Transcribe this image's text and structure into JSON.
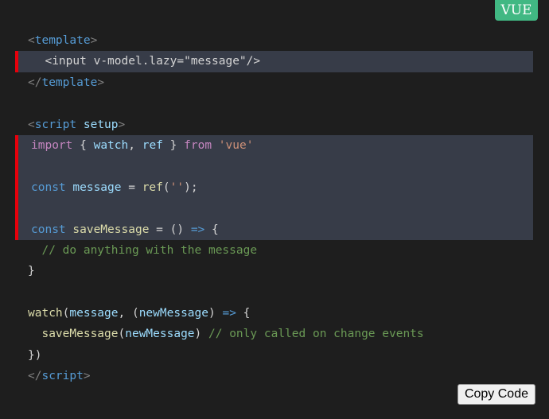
{
  "badge": {
    "label": "VUE",
    "color": "#41b883"
  },
  "copy_button": {
    "label": "Copy Code"
  },
  "highlight_color": "#e8000b",
  "code": {
    "l1": [
      "<",
      "template",
      ">"
    ],
    "l2": [
      "  <",
      "input",
      " ",
      "v-model.lazy",
      "=",
      "\"message\"",
      "/>"
    ],
    "l3": [
      "</",
      "template",
      ">"
    ],
    "l5": [
      "<",
      "script",
      " ",
      "setup",
      ">"
    ],
    "l6": [
      "import",
      " { ",
      "watch",
      ", ",
      "ref",
      " } ",
      "from",
      " ",
      "'vue'"
    ],
    "l8": [
      "const",
      " ",
      "message",
      " = ",
      "ref",
      "(",
      "''",
      ");"
    ],
    "l10": [
      "const",
      " ",
      "saveMessage",
      " = () ",
      "=>",
      " {"
    ],
    "l11": [
      "  // do anything with the message"
    ],
    "l12": [
      "}"
    ],
    "l14": [
      "watch",
      "(",
      "message",
      ", (",
      "newMessage",
      ") ",
      "=>",
      " {"
    ],
    "l15": [
      "  ",
      "saveMessage",
      "(",
      "newMessage",
      ") ",
      "// only called on change events"
    ],
    "l16": [
      "})"
    ],
    "l17": [
      "</",
      "script",
      ">"
    ]
  }
}
